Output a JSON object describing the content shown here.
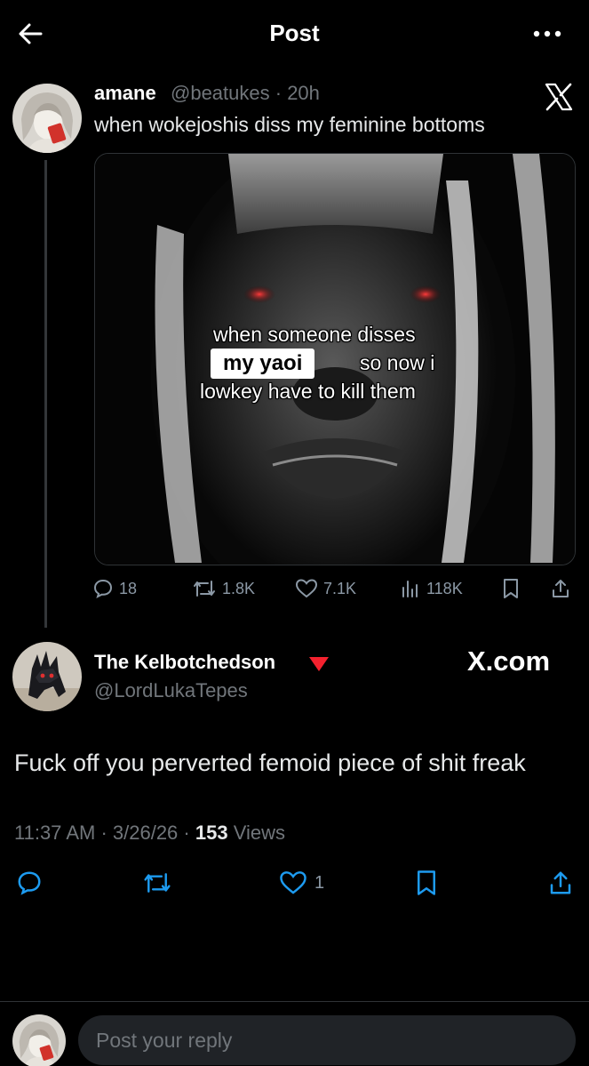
{
  "header": {
    "title": "Post"
  },
  "quoted": {
    "name": "amane",
    "handle": "@beatukes",
    "time": "20h",
    "text": "when wokejoshis diss my feminine bottoms",
    "caption_line1": "when someone disses",
    "caption_highlight": "my yaoi",
    "caption_line2b": "so now i",
    "caption_line3": "lowkey have to kill them",
    "metrics": {
      "replies": "18",
      "reposts": "1.8K",
      "likes": "7.1K",
      "views": "118K"
    }
  },
  "reply": {
    "name": "The Kelbotchedson",
    "handle": "@LordLukaTepes",
    "watermark": "X.com",
    "text": "Fuck off you perverted femoid piece of shit freak",
    "time": "11:37 AM",
    "date": "3/26/26",
    "views_count": "153",
    "views_label": "Views",
    "likes": "1"
  },
  "composer": {
    "placeholder": "Post your reply"
  },
  "colors": {
    "background": "#000000",
    "muted": "#71767b",
    "badge": "#f4212e"
  },
  "icons": [
    "back-arrow-icon",
    "more-icon",
    "x-logo-icon",
    "reply-icon",
    "repost-icon",
    "like-icon",
    "views-icon",
    "bookmark-icon",
    "share-icon",
    "red-triangle-icon"
  ]
}
